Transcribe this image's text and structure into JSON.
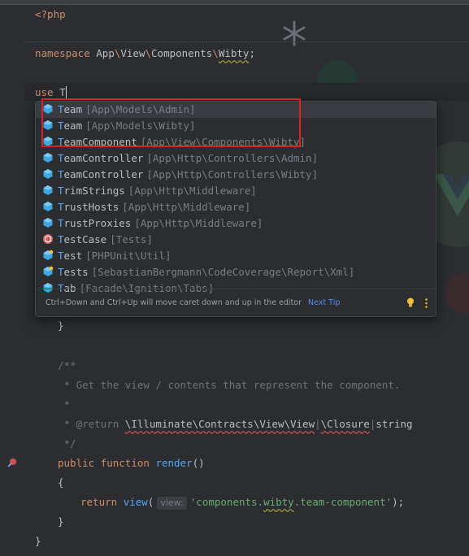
{
  "code": {
    "php_open": "<?php",
    "namespace_kw": "namespace",
    "namespace_path": [
      "App",
      "View",
      "Components",
      "Wibty"
    ],
    "namespace_end": ";",
    "use_kw": "use",
    "use_typed": "T",
    "brace_close_inner": "}",
    "doc_open": "/**",
    "doc_line1": " * Get the view / contents that represent the component.",
    "doc_star": " *",
    "doc_return_tag": " * @return",
    "doc_return_type1": "\\Illuminate\\Contracts\\View\\View",
    "doc_pipe": "|",
    "doc_return_type2": "\\Closure",
    "doc_return_type3": "string",
    "doc_close": " */",
    "method_public": "public",
    "method_function": "function",
    "method_name": "render",
    "method_parens": "()",
    "brace_open": "{",
    "return_kw": "return",
    "return_fn": "view",
    "param_hint": "view:",
    "return_str_pre": "'components.",
    "return_str_mid": "wibty",
    "return_str_post": ".team-component'",
    "return_end": ");",
    "brace_close_method": "}",
    "brace_close_class": "}"
  },
  "autocomplete": {
    "typed_prefix": "T",
    "items": [
      {
        "name": "Team",
        "match": "T",
        "rest": "eam",
        "package": "[App\\Models\\Admin]",
        "icon": "class-icon"
      },
      {
        "name": "Team",
        "match": "T",
        "rest": "eam",
        "package": "[App\\Models\\Wibty]",
        "icon": "class-icon"
      },
      {
        "name": "TeamComponent",
        "match": "T",
        "rest": "eamComponent",
        "package": "[App\\View\\Components\\Wibty]",
        "icon": "class-icon"
      },
      {
        "name": "TeamController",
        "match": "T",
        "rest": "eamController",
        "package": "[App\\Http\\Controllers\\Admin]",
        "icon": "class-icon"
      },
      {
        "name": "TeamController",
        "match": "T",
        "rest": "eamController",
        "package": "[App\\Http\\Controllers\\Wibty]",
        "icon": "class-icon"
      },
      {
        "name": "TrimStrings",
        "match": "T",
        "rest": "rimStrings",
        "package": "[App\\Http\\Middleware]",
        "icon": "class-icon"
      },
      {
        "name": "TrustHosts",
        "match": "T",
        "rest": "rustHosts",
        "package": "[App\\Http\\Middleware]",
        "icon": "class-icon"
      },
      {
        "name": "TrustProxies",
        "match": "T",
        "rest": "rustProxies",
        "package": "[App\\Http\\Middleware]",
        "icon": "class-icon"
      },
      {
        "name": "TestCase",
        "match": "T",
        "rest": "estCase",
        "package": "[Tests]",
        "icon": "abstract-class-icon"
      },
      {
        "name": "Test",
        "match": "T",
        "rest": "est",
        "package": "[PHPUnit\\Util]",
        "icon": "final-class-icon"
      },
      {
        "name": "Tests",
        "match": "T",
        "rest": "ests",
        "package": "[SebastianBergmann\\CodeCoverage\\Report\\Xml]",
        "icon": "final-class-icon"
      },
      {
        "name": "Tab",
        "match": "T",
        "rest": "ab",
        "package": "[Facade\\Ignition\\Tabs]",
        "icon": "class-icon"
      }
    ],
    "footer_text": "Ctrl+Down and Ctrl+Up will move caret down and up in the editor",
    "footer_link": "Next Tip",
    "colors": {
      "selected_bg": "#393b40",
      "match": "#56a8f5",
      "highlight_box": "#d8232a"
    }
  }
}
